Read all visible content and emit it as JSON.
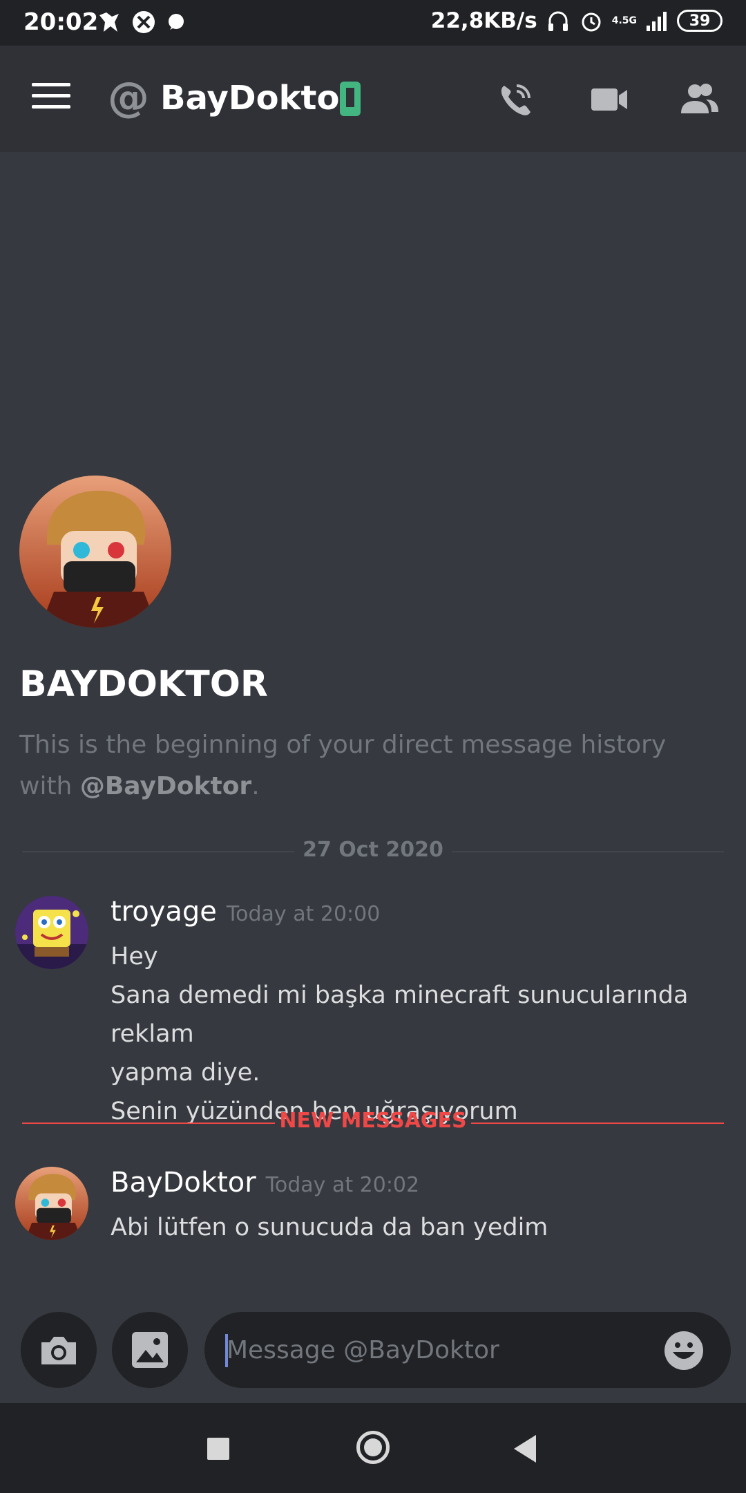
{
  "status_bar": {
    "time": "20:02",
    "net_speed": "22,8KB/s",
    "network": "4.5G",
    "battery": "39"
  },
  "header": {
    "at_symbol": "@",
    "title": "BayDoktor",
    "status_icon": "mobile-online-icon",
    "actions": [
      "phone-call-icon",
      "video-call-icon",
      "members-icon"
    ]
  },
  "intro": {
    "name": "BAYDOKTOR",
    "desc_text": "This is the beginning of your direct message history with",
    "desc_mention": "@BayDoktor",
    "desc_end": "."
  },
  "date_divider": "27 Oct 2020",
  "new_divider": "NEW MESSAGES",
  "messages": [
    {
      "author": "troyage",
      "time": "Today at 20:00",
      "lines": [
        "Hey",
        "Sana demedi mi başka minecraft sunucularında reklam",
        "yapma diye.",
        "Senin yüzünden ben uğraşıyorum"
      ]
    },
    {
      "author": "BayDoktor",
      "time": "Today at 20:02",
      "lines": [
        "Abi lütfen o sunucuda da ban yedim"
      ]
    }
  ],
  "input": {
    "placeholder": "Message @BayDoktor"
  },
  "colors": {
    "background": "#36393f",
    "header": "#2f3136",
    "accent_online": "#43b581",
    "new_messages": "#f04747"
  }
}
